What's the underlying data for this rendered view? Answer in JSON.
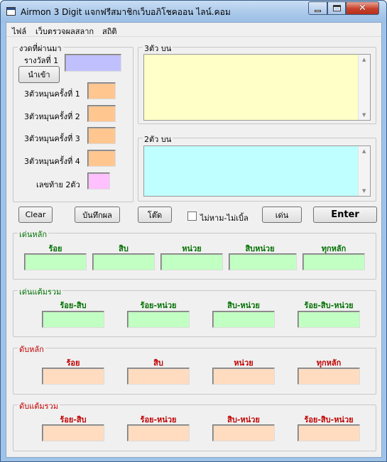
{
  "window": {
    "title": "Airmon 3 Digit แจกฟรีสมาชิกเว็บอภิโชคออน ไลน์.คอม"
  },
  "menu": {
    "items": [
      "ไฟล์",
      "เว็บตรวจผลสลาก",
      "สถิติ"
    ]
  },
  "past": {
    "group_label": "งวดที่ผ่านมา",
    "prize1_label": "รางวัลที่ 1",
    "import_button": "นำเข้า",
    "spin_labels": [
      "3ตัวหมุนครั้งที่ 1",
      "3ตัวหมุนครั้งที่ 2",
      "3ตัวหมุนครั้งที่ 3",
      "3ตัวหมุนครั้งที่ 4"
    ],
    "last2_label": "เลขท้าย 2ตัว"
  },
  "top3": {
    "group_label": "3ตัว บน"
  },
  "top2": {
    "group_label": "2ตัว บน"
  },
  "actions": {
    "clear": "Clear",
    "save": "บันทึกผล",
    "toto": "โต๊ด",
    "no_double": "ไม่หาม-ไม่เบิ้ล",
    "play": "เด่น",
    "enter": "Enter"
  },
  "main_digit": {
    "group_label": "เด่นหลัก",
    "columns": [
      "ร้อย",
      "สิบ",
      "หน่วย",
      "สิบหน่วย",
      "ทุกหลัก"
    ]
  },
  "main_sum": {
    "group_label": "เด่นแต้มรวม",
    "columns": [
      "ร้อย-สิบ",
      "ร้อย-หน่วย",
      "สิบ-หน่วย",
      "ร้อย-สิบ-หน่วย"
    ]
  },
  "cut_digit": {
    "group_label": "ดับหลัก",
    "columns": [
      "ร้อย",
      "สิบ",
      "หน่วย",
      "ทุกหลัก"
    ]
  },
  "cut_sum": {
    "group_label": "ดับแต้มรวม",
    "columns": [
      "ร้อย-สิบ",
      "ร้อย-หน่วย",
      "สิบ-หน่วย",
      "ร้อย-สิบ-หน่วย"
    ]
  },
  "colors": {
    "green_label": "#007000",
    "red_label": "#c00000",
    "prize_field": "#c0c0ff",
    "spin_field": "#ffc690",
    "last2_field": "#ffc0ff",
    "main_field": "#c2ffc2",
    "cut_field": "#ffdcc0",
    "top3_area": "#ffffc8",
    "top2_area": "#c0ffff"
  }
}
